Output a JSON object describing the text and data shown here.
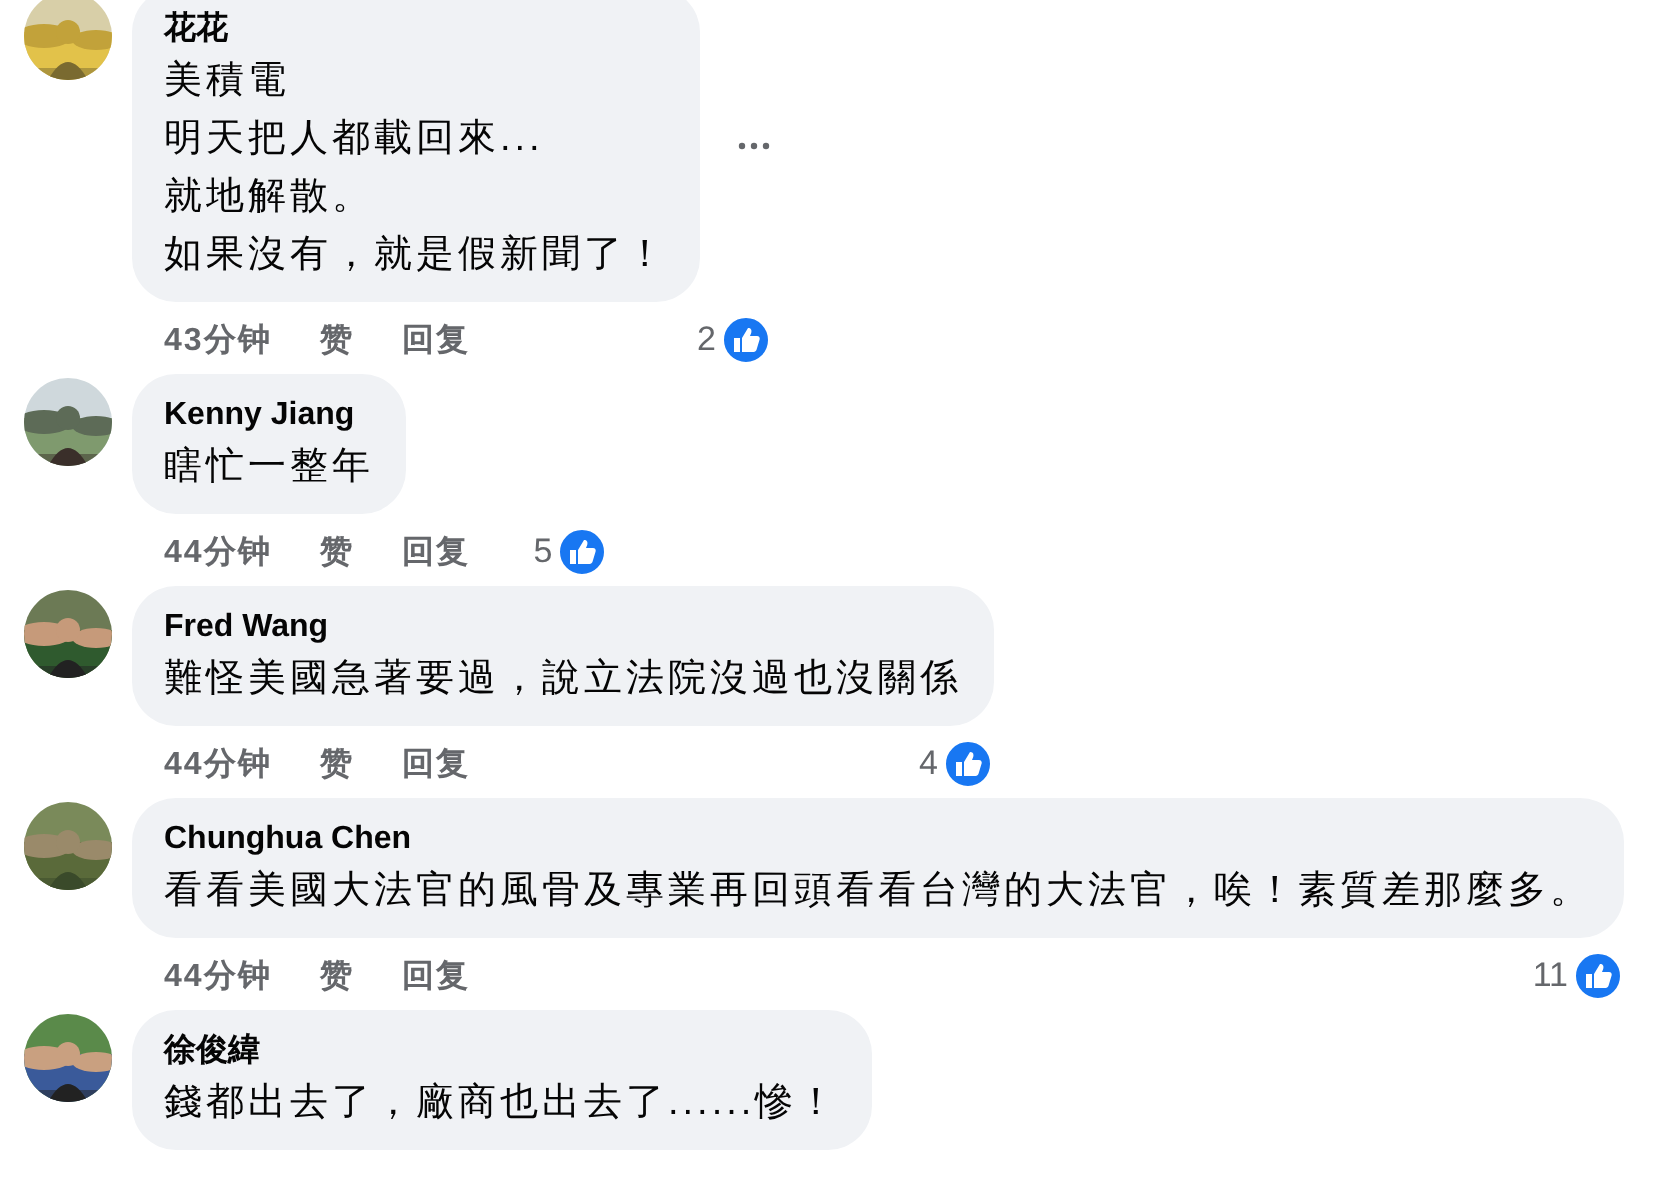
{
  "comments": [
    {
      "author": "花花",
      "lines": [
        "美積電",
        "明天把人都載回來...",
        "就地解散。",
        "如果沒有，就是假新聞了！"
      ],
      "time": "43分钟",
      "like": "赞",
      "reply": "回复",
      "reactions": "2",
      "has_menu": true
    },
    {
      "author": "Kenny Jiang",
      "lines": [
        "瞎忙一整年"
      ],
      "time": "44分钟",
      "like": "赞",
      "reply": "回复",
      "reactions": "5",
      "has_menu": false
    },
    {
      "author": "Fred Wang",
      "lines": [
        "難怪美國急著要過，說立法院沒過也沒關係"
      ],
      "time": "44分钟",
      "like": "赞",
      "reply": "回复",
      "reactions": "4",
      "has_menu": false
    },
    {
      "author": "Chunghua Chen",
      "lines": [
        "看看美國大法官的風骨及專業再回頭看看台灣的大法官，唉！素質差那麼多。"
      ],
      "time": "44分钟",
      "like": "赞",
      "reply": "回复",
      "reactions": "11",
      "has_menu": false
    },
    {
      "author": "徐俊緯",
      "lines": [
        "錢都出去了，廠商也出去了......慘！"
      ],
      "has_menu": false
    }
  ]
}
